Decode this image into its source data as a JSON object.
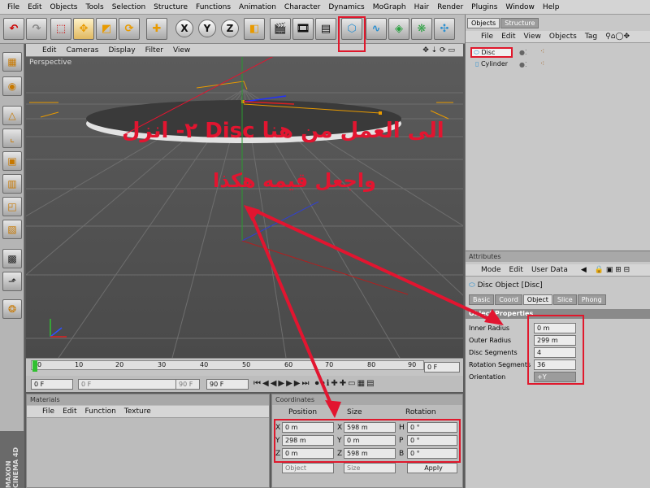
{
  "menubar": [
    "File",
    "Edit",
    "Objects",
    "Tools",
    "Selection",
    "Structure",
    "Functions",
    "Animation",
    "Character",
    "Dynamics",
    "MoGraph",
    "Hair",
    "Render",
    "Plugins",
    "Window",
    "Help"
  ],
  "toolbar": {
    "axis_x": "X",
    "axis_y": "Y",
    "axis_z": "Z"
  },
  "viewport": {
    "menu": [
      "Edit",
      "Cameras",
      "Display",
      "Filter",
      "View"
    ],
    "label": "Perspective"
  },
  "timeline": {
    "ticks": [
      "0",
      "10",
      "20",
      "30",
      "40",
      "50",
      "60",
      "70",
      "80",
      "90"
    ],
    "current_frame": "0 F",
    "start_frame": "0 F",
    "end_frame": "90 F",
    "min_field": "0 F",
    "max_field": "90 F"
  },
  "materials": {
    "title": "Materials",
    "menu": [
      "File",
      "Edit",
      "Function",
      "Texture"
    ]
  },
  "coordinates": {
    "title": "Coordinates",
    "headers": [
      "Position",
      "Size",
      "Rotation"
    ],
    "rows": [
      {
        "axis": "X",
        "pos": "0 m",
        "size_axis": "X",
        "size": "598 m",
        "rot_axis": "H",
        "rot": "0 °"
      },
      {
        "axis": "Y",
        "pos": "298 m",
        "size_axis": "Y",
        "size": "0 m",
        "rot_axis": "P",
        "rot": "0 °"
      },
      {
        "axis": "Z",
        "pos": "0 m",
        "size_axis": "Z",
        "size": "598 m",
        "rot_axis": "B",
        "rot": "0 °"
      }
    ],
    "mode_select": "Object",
    "size_select": "Size",
    "apply_label": "Apply"
  },
  "objects": {
    "tabs": [
      "Objects",
      "Structure"
    ],
    "menu": [
      "File",
      "Edit",
      "View",
      "Objects",
      "Tag"
    ],
    "items": [
      {
        "name": "Disc"
      },
      {
        "name": "Cylinder"
      }
    ]
  },
  "attributes": {
    "title": "Attributes",
    "menu": [
      "Mode",
      "Edit",
      "User Data"
    ],
    "object_title": "Disc Object [Disc]",
    "tabs": [
      "Basic",
      "Coord",
      "Object",
      "Slice",
      "Phong"
    ],
    "section": "Object Properties",
    "props": [
      {
        "label": "Inner Radius",
        "value": "0 m"
      },
      {
        "label": "Outer Radius",
        "value": "299 m"
      },
      {
        "label": "Disc Segments",
        "value": "4"
      },
      {
        "label": "Rotation Segments",
        "value": "36"
      },
      {
        "label": "Orientation",
        "value": "+Y"
      }
    ]
  },
  "annotations": {
    "line1": "٢- انزل  Disc  الى العمل من هنا",
    "line2": "واجعل قيمه هكذا"
  },
  "brand": "MAXON CINEMA 4D",
  "colors": {
    "annotation_red": "#e21530",
    "accent_orange": "#e89a00"
  }
}
